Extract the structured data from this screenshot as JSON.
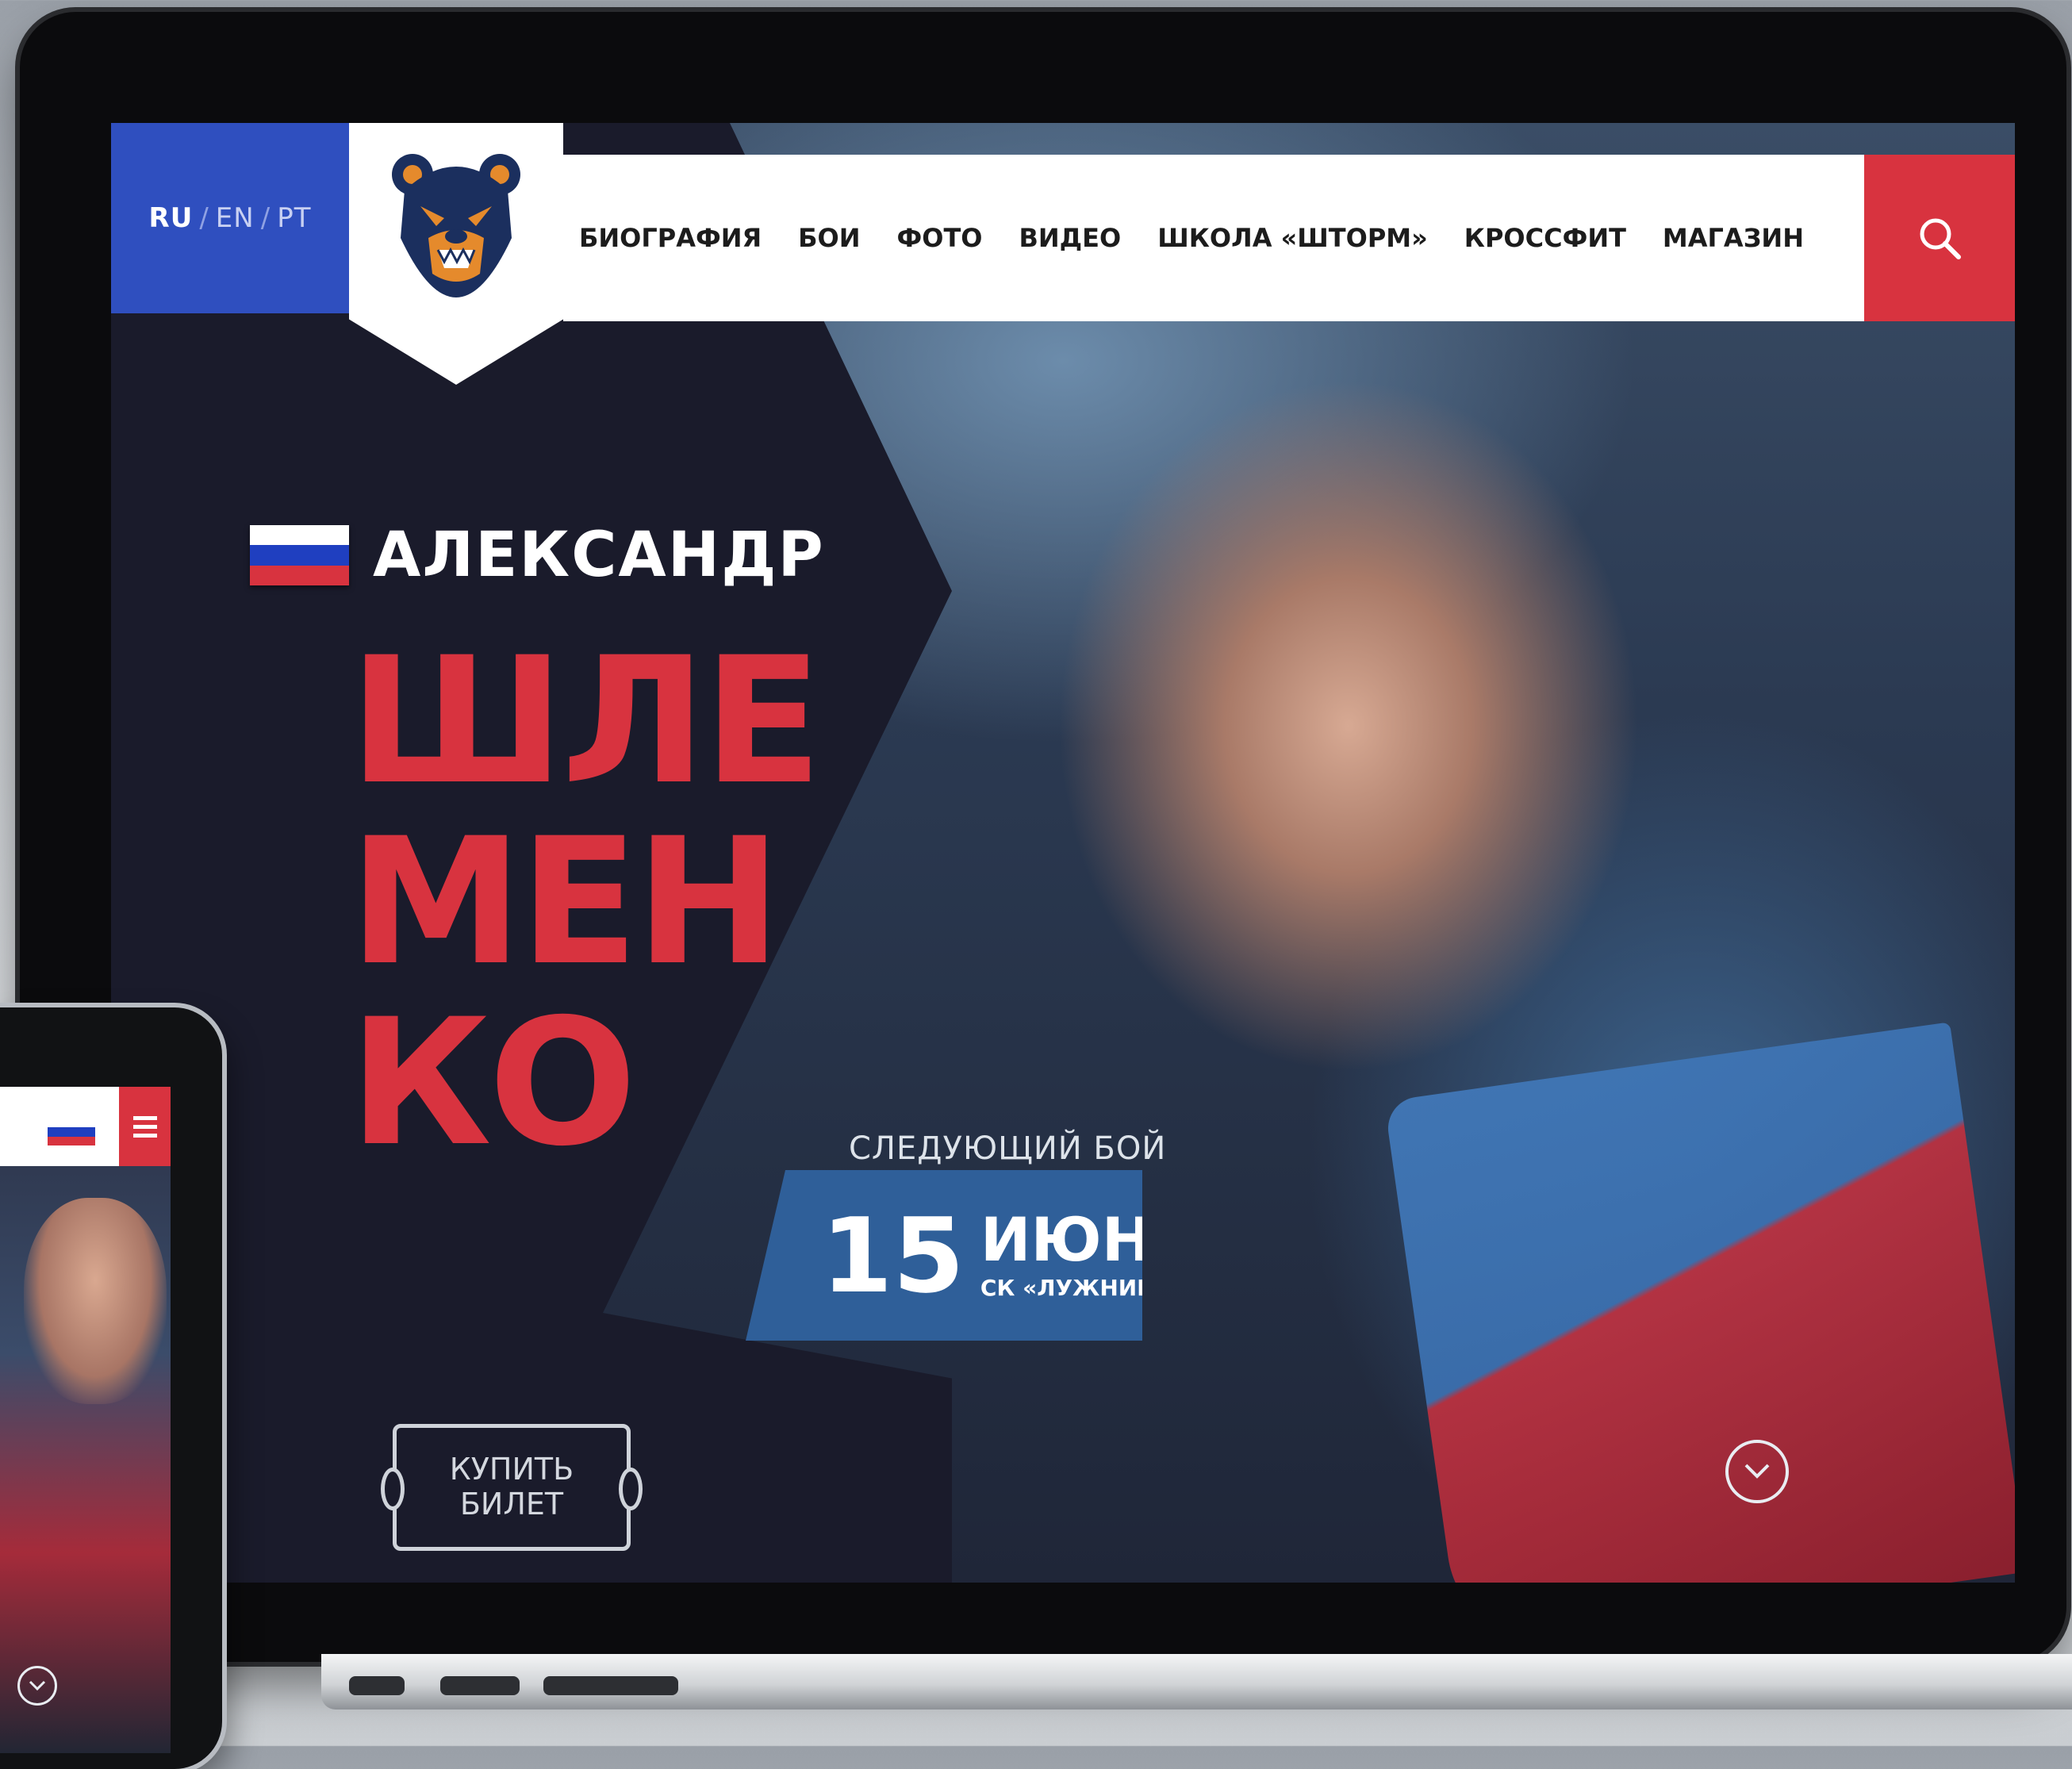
{
  "header": {
    "languages": [
      {
        "code": "RU",
        "active": true
      },
      {
        "code": "EN",
        "active": false
      },
      {
        "code": "PT",
        "active": false
      }
    ],
    "lang_separator": "/",
    "logo_icon": "bear-logo-icon",
    "nav_items": [
      "БИОГРАФИЯ",
      "БОИ",
      "ФОТО",
      "ВИДЕО",
      "ШКОЛА «ШТОРМ»",
      "КРОССФИТ",
      "МАГАЗИН"
    ],
    "search_icon": "search-icon"
  },
  "hero": {
    "flag_icon": "russia-flag-icon",
    "first_name": "АЛЕКСАНДР",
    "last_name_lines": [
      "ШЛЕ",
      "МЕН",
      "КО"
    ]
  },
  "next_fight": {
    "label": "СЛЕДУЮЩИЙ БОЙ",
    "day": "15",
    "month": "ИЮНЯ",
    "venue": "СК «ЛУЖНИКИ»"
  },
  "ticket_button": {
    "line1": "КУПИТЬ",
    "line2": "БИЛЕТ"
  },
  "scroll_icon": "chevron-down-circle-icon",
  "phone": {
    "menu_icon": "hamburger-icon",
    "flag_icon": "russia-flag-icon",
    "scroll_icon": "chevron-down-circle-icon"
  },
  "colors": {
    "accent_red": "#d8333f",
    "lang_blue": "#2f4fbf",
    "date_blue": "#2f5f99",
    "panel_dark": "#1a1b2b",
    "flag_white": "#ffffff",
    "flag_blue": "#1f3fc0",
    "flag_red": "#d8333f"
  }
}
